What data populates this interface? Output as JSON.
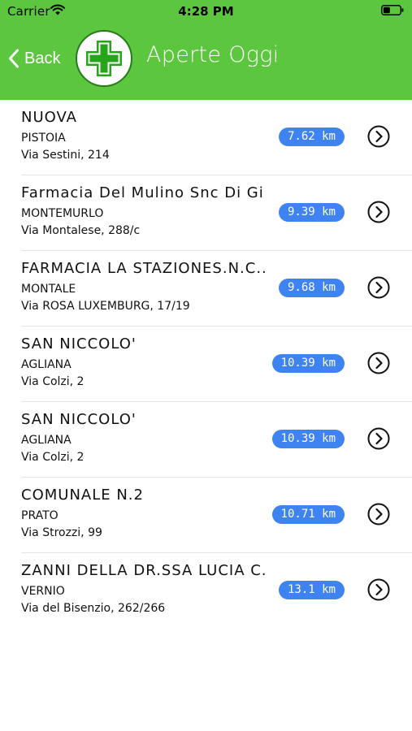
{
  "status": {
    "carrier": "Carrier",
    "time": "4:28 PM"
  },
  "nav": {
    "back_label": "Back",
    "title": "Aperte Oggi"
  },
  "colors": {
    "header": "#5cc63f",
    "badge": "#3f83f0"
  },
  "pharmacies": [
    {
      "name": "NUOVA",
      "city": "PISTOIA",
      "address": "Via Sestini, 214",
      "distance": "7.62 km"
    },
    {
      "name": "Farmacia Del Mulino Snc Di Gi...",
      "city": "MONTEMURLO",
      "address": "Via Montalese, 288/c",
      "distance": "9.39 km"
    },
    {
      "name": "FARMACIA LA STAZIONES.N.C...",
      "city": "MONTALE",
      "address": "Via ROSA LUXEMBURG, 17/19",
      "distance": "9.68 km"
    },
    {
      "name": "SAN NICCOLO'",
      "city": "AGLIANA",
      "address": "Via Colzi, 2",
      "distance": "10.39 km"
    },
    {
      "name": "SAN NICCOLO'",
      "city": "AGLIANA",
      "address": "Via Colzi, 2",
      "distance": "10.39 km"
    },
    {
      "name": "COMUNALE N.2",
      "city": "PRATO",
      "address": "Via Strozzi, 99",
      "distance": "10.71 km"
    },
    {
      "name": "ZANNI DELLA DR.SSA LUCIA C...",
      "city": "VERNIO",
      "address": "Via del Bisenzio, 262/266",
      "distance": "13.1 km"
    }
  ]
}
